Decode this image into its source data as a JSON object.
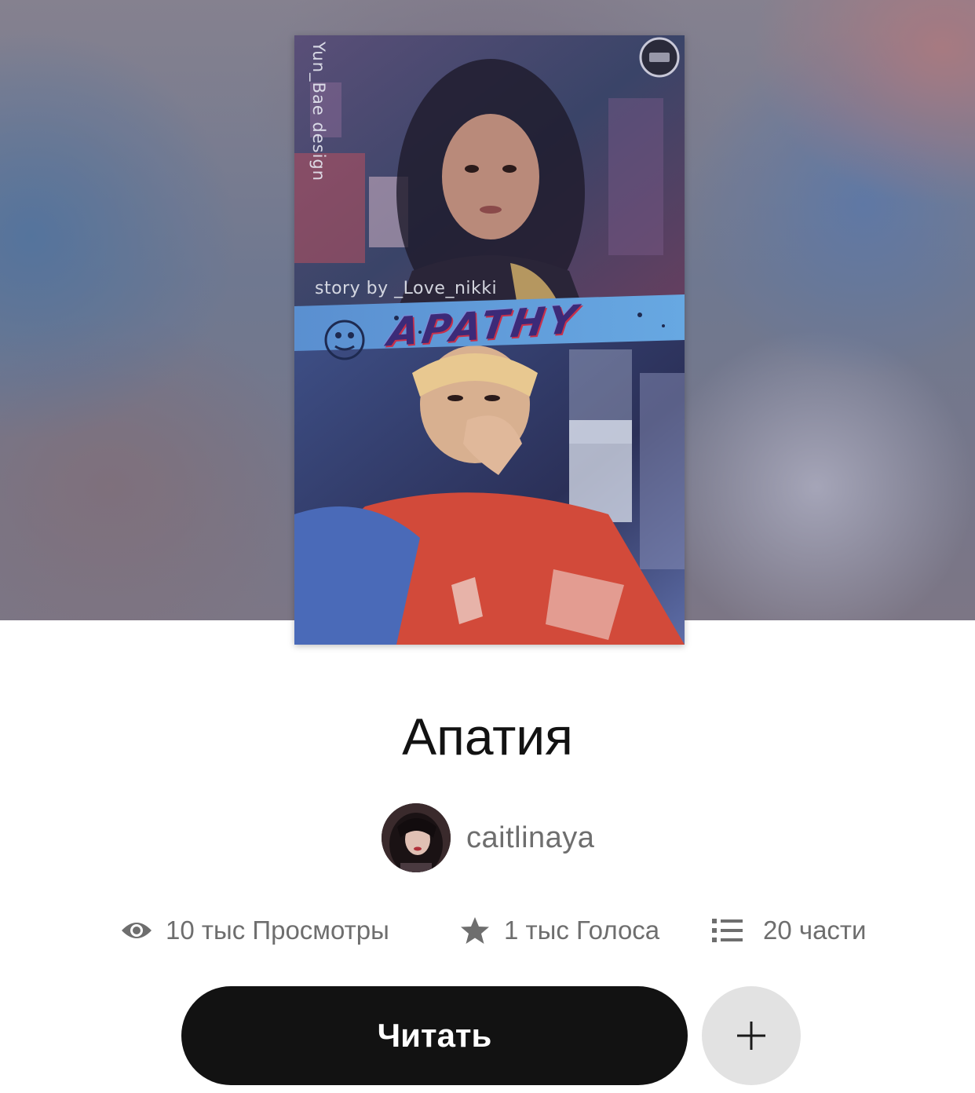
{
  "cover": {
    "designer_credit": "Yun_Bae design",
    "story_credit": "story  by  _Love_nikki",
    "cover_title": "APATHY"
  },
  "story": {
    "title": "Апатия"
  },
  "author": {
    "name": "caitlinaya"
  },
  "stats": {
    "views": "10 тыс Просмотры",
    "votes": "1 тыс Голоса",
    "parts": "20 части"
  },
  "actions": {
    "read_label": "Читать",
    "add_label": "+"
  },
  "icons": {
    "views": "eye-icon",
    "votes": "star-icon",
    "parts": "list-icon",
    "add": "plus-icon"
  },
  "colors": {
    "primary_button": "#121212",
    "secondary_button": "#e2e2e2",
    "stat_text": "#6e6e6e",
    "title_text": "#121212"
  }
}
